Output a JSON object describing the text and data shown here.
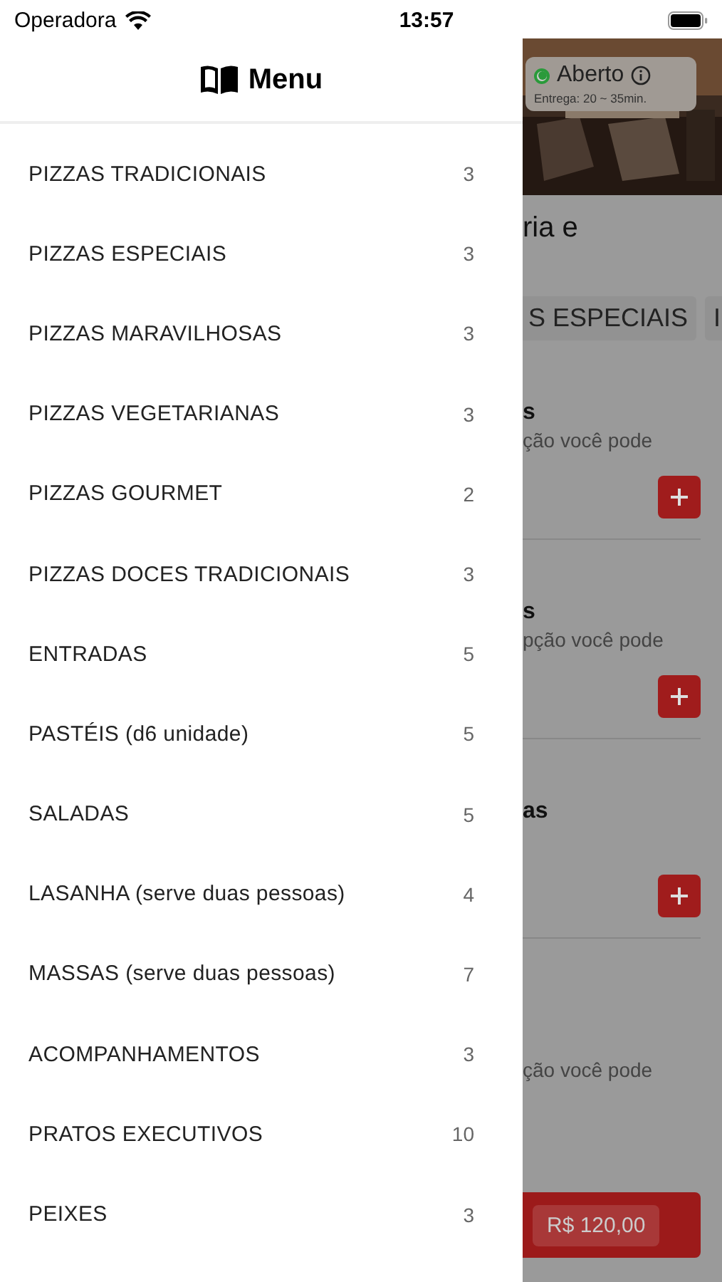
{
  "status_bar": {
    "carrier": "Operadora",
    "time": "13:57"
  },
  "drawer": {
    "title": "Menu",
    "categories": [
      {
        "name": "PIZZAS TRADICIONAIS",
        "count": "3"
      },
      {
        "name": "PIZZAS ESPECIAIS",
        "count": "3"
      },
      {
        "name": "PIZZAS MARAVILHOSAS",
        "count": "3"
      },
      {
        "name": "PIZZAS VEGETARIANAS",
        "count": "3"
      },
      {
        "name": "PIZZAS GOURMET",
        "count": "2"
      },
      {
        "name": "PIZZAS DOCES TRADICIONAIS",
        "count": "3"
      },
      {
        "name": "ENTRADAS",
        "count": "5"
      },
      {
        "name": "PASTÉIS (d6 unidade)",
        "count": "5"
      },
      {
        "name": "SALADAS",
        "count": "5"
      },
      {
        "name": "LASANHA (serve duas pessoas)",
        "count": "4"
      },
      {
        "name": "MASSAS (serve duas pessoas)",
        "count": "7"
      },
      {
        "name": "ACOMPANHAMENTOS",
        "count": "3"
      },
      {
        "name": "PRATOS EXECUTIVOS",
        "count": "10"
      },
      {
        "name": "PEIXES",
        "count": "3"
      }
    ]
  },
  "background": {
    "status": {
      "label": "Aberto",
      "open": true,
      "delivery": "Entrega: 20 ~ 35min."
    },
    "title": "ria e",
    "tabs": [
      {
        "label": "S ESPECIAIS"
      },
      {
        "label": "I"
      }
    ],
    "items": [
      {
        "name": "s",
        "description": "ção você pode",
        "add": true
      },
      {
        "name": "s",
        "description": "pção você pode",
        "add": true
      },
      {
        "name": "as",
        "add": true
      },
      {
        "description": "ção você pode",
        "add": false
      }
    ],
    "cart": {
      "total": "R$ 120,00"
    }
  }
}
